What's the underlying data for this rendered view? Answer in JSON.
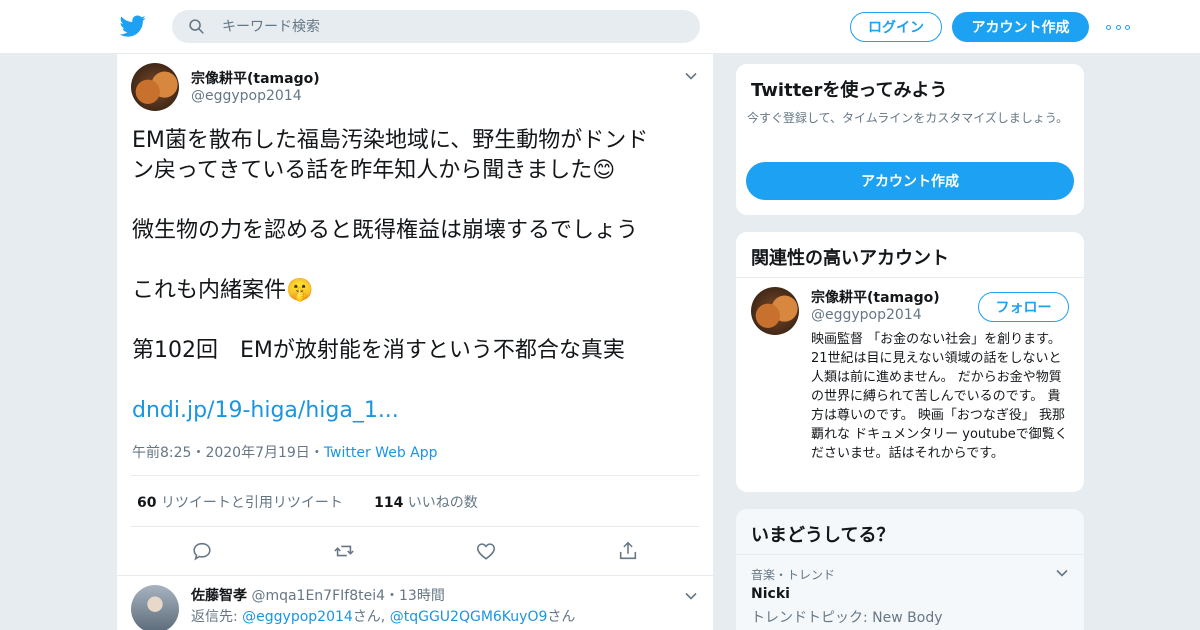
{
  "header": {
    "search_placeholder": "キーワード検索",
    "login_label": "ログイン",
    "signup_label": "アカウント作成"
  },
  "tweet": {
    "author_name": "宗像耕平(tamago)",
    "author_handle": "@eggypop2014",
    "text_lines": [
      "EM菌を散布した福島汚染地域に、野生動物がドンド",
      "ン戻ってきている話を昨年知人から聞きました😊",
      "微生物の力を認めると既得権益は崩壊するでしょう",
      "これも内緒案件🤫",
      "第102回　EMが放射能を消すという不都合な真実"
    ],
    "link": "dndi.jp/19-higa/higa_1...",
    "time": "午前8:25",
    "date": "2020年7月19日",
    "source": "Twitter Web App",
    "retweets_count": "60",
    "retweets_label": "リツイートと引用リツイート",
    "likes_count": "114",
    "likes_label": "いいねの数"
  },
  "reply": {
    "name": "佐藤智孝",
    "handle": "@mqa1En7FIf8tei4",
    "time": "13時間",
    "reply_prefix": "返信先:",
    "mention1": "@eggypop2014",
    "honorific1": "さん,",
    "mention2": "@tqGGU2QGM6KuyO9",
    "honorific2": "さん"
  },
  "signup_card": {
    "title": "Twitterを使ってみよう",
    "subtitle": "今すぐ登録して、タイムラインをカスタマイズしましょう。",
    "button": "アカウント作成"
  },
  "related_card": {
    "title": "関連性の高いアカウント",
    "name": "宗像耕平(tamago)",
    "handle": "@eggypop2014",
    "follow_label": "フォロー",
    "bio": "映画監督 「お金のない社会」を創ります。 21世紀は目に見えない領域の話をしないと 人類は前に進めません。 だからお金や物質の世界に縛られて苦しんでいるのです。 貴方は尊いのです。 映画「おつなぎ役」 我那覇れな ドキュメンタリー youtubeで御覧くださいませ。話はそれからです。"
  },
  "trends_card": {
    "title": "いまどうしてる？",
    "trend_meta": "音楽・トレンド",
    "trend_name": "Nicki",
    "trend_info": "トレンドトピック: New Body"
  },
  "colors": {
    "accent": "#1da1f2",
    "link": "#1b95e0",
    "muted": "#657786",
    "background": "#e6ecf0"
  },
  "icons": [
    "twitter-bird-icon",
    "search-icon",
    "more-icon",
    "chevron-down-icon",
    "reply-icon",
    "retweet-icon",
    "like-icon",
    "share-icon"
  ]
}
